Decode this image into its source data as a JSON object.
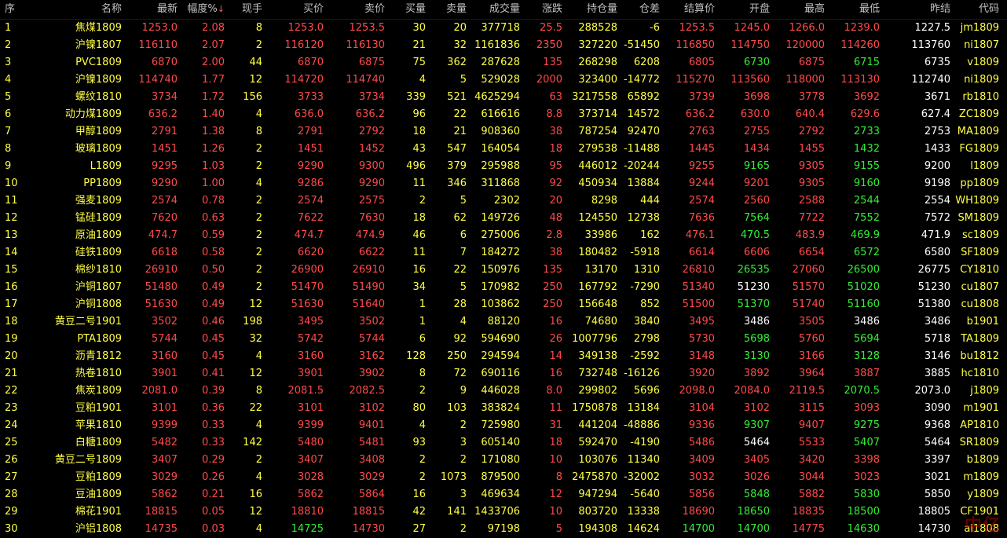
{
  "colors": {
    "up": "#ff4a4a",
    "down": "#33ee33",
    "neutral": "#ffffff",
    "text": "#ffff44",
    "header": "#c0c0c0",
    "bg": "#000000"
  },
  "headers": [
    "序",
    "名称",
    "最新",
    "幅度%",
    "现手",
    "买价",
    "卖价",
    "买量",
    "卖量",
    "成交量",
    "涨跌",
    "持仓量",
    "仓差",
    "结算价",
    "开盘",
    "最高",
    "最低",
    "昨结",
    "代码"
  ],
  "sort_indicator": "↓",
  "watermark": "中亿",
  "rows": [
    {
      "idx": "1",
      "name": "焦煤1809",
      "last": "1253.0",
      "pct": "2.08",
      "vol": "8",
      "bid": "1253.0",
      "ask": "1253.5",
      "bidv": "30",
      "askv": "20",
      "turnover": "377718",
      "chg": "25.5",
      "oi": "288528",
      "oid": "-6",
      "settle": "1253.5",
      "open": "1245.0",
      "high": "1266.0",
      "low": "1239.0",
      "prev": "1227.5",
      "code": "jm1809",
      "open_c": "up",
      "high_c": "up",
      "low_c": "up"
    },
    {
      "idx": "2",
      "name": "沪镍1807",
      "last": "116110",
      "pct": "2.07",
      "vol": "2",
      "bid": "116120",
      "ask": "116130",
      "bidv": "21",
      "askv": "32",
      "turnover": "1161836",
      "chg": "2350",
      "oi": "327220",
      "oid": "-51450",
      "settle": "116850",
      "open": "114750",
      "high": "120000",
      "low": "114260",
      "prev": "113760",
      "code": "ni1807",
      "open_c": "up",
      "high_c": "up",
      "low_c": "up"
    },
    {
      "idx": "3",
      "name": "PVC1809",
      "last": "6870",
      "pct": "2.00",
      "vol": "44",
      "bid": "6870",
      "ask": "6875",
      "bidv": "75",
      "askv": "362",
      "turnover": "287628",
      "chg": "135",
      "oi": "268298",
      "oid": "6208",
      "settle": "6805",
      "open": "6730",
      "high": "6875",
      "low": "6715",
      "prev": "6735",
      "code": "v1809",
      "open_c": "down",
      "high_c": "up",
      "low_c": "down"
    },
    {
      "idx": "4",
      "name": "沪镍1809",
      "last": "114740",
      "pct": "1.77",
      "vol": "12",
      "bid": "114720",
      "ask": "114740",
      "bidv": "4",
      "askv": "5",
      "turnover": "529028",
      "chg": "2000",
      "oi": "323400",
      "oid": "-14772",
      "settle": "115270",
      "open": "113560",
      "high": "118000",
      "low": "113130",
      "prev": "112740",
      "code": "ni1809",
      "open_c": "up",
      "high_c": "up",
      "low_c": "up"
    },
    {
      "idx": "5",
      "name": "螺纹1810",
      "last": "3734",
      "pct": "1.72",
      "vol": "156",
      "bid": "3733",
      "ask": "3734",
      "bidv": "339",
      "askv": "521",
      "turnover": "4625294",
      "chg": "63",
      "oi": "3217558",
      "oid": "65892",
      "settle": "3739",
      "open": "3698",
      "high": "3778",
      "low": "3692",
      "prev": "3671",
      "code": "rb1810",
      "open_c": "up",
      "high_c": "up",
      "low_c": "up"
    },
    {
      "idx": "6",
      "name": "动力煤1809",
      "last": "636.2",
      "pct": "1.40",
      "vol": "4",
      "bid": "636.0",
      "ask": "636.2",
      "bidv": "96",
      "askv": "22",
      "turnover": "616616",
      "chg": "8.8",
      "oi": "373714",
      "oid": "14572",
      "settle": "636.2",
      "open": "630.0",
      "high": "640.4",
      "low": "629.6",
      "prev": "627.4",
      "code": "ZC1809",
      "open_c": "up",
      "high_c": "up",
      "low_c": "up"
    },
    {
      "idx": "7",
      "name": "甲醇1809",
      "last": "2791",
      "pct": "1.38",
      "vol": "8",
      "bid": "2791",
      "ask": "2792",
      "bidv": "18",
      "askv": "21",
      "turnover": "908360",
      "chg": "38",
      "oi": "787254",
      "oid": "92470",
      "settle": "2763",
      "open": "2755",
      "high": "2792",
      "low": "2733",
      "prev": "2753",
      "code": "MA1809",
      "open_c": "up",
      "high_c": "up",
      "low_c": "down"
    },
    {
      "idx": "8",
      "name": "玻璃1809",
      "last": "1451",
      "pct": "1.26",
      "vol": "2",
      "bid": "1451",
      "ask": "1452",
      "bidv": "43",
      "askv": "547",
      "turnover": "164054",
      "chg": "18",
      "oi": "279538",
      "oid": "-11488",
      "settle": "1445",
      "open": "1434",
      "high": "1455",
      "low": "1432",
      "prev": "1433",
      "code": "FG1809",
      "open_c": "up",
      "high_c": "up",
      "low_c": "down"
    },
    {
      "idx": "9",
      "name": "L1809",
      "last": "9295",
      "pct": "1.03",
      "vol": "2",
      "bid": "9290",
      "ask": "9300",
      "bidv": "496",
      "askv": "379",
      "turnover": "295988",
      "chg": "95",
      "oi": "446012",
      "oid": "-20244",
      "settle": "9255",
      "open": "9165",
      "high": "9305",
      "low": "9155",
      "prev": "9200",
      "code": "l1809",
      "open_c": "down",
      "high_c": "up",
      "low_c": "down"
    },
    {
      "idx": "10",
      "name": "PP1809",
      "last": "9290",
      "pct": "1.00",
      "vol": "4",
      "bid": "9286",
      "ask": "9290",
      "bidv": "11",
      "askv": "346",
      "turnover": "311868",
      "chg": "92",
      "oi": "450934",
      "oid": "13884",
      "settle": "9244",
      "open": "9201",
      "high": "9305",
      "low": "9160",
      "prev": "9198",
      "code": "pp1809",
      "open_c": "up",
      "high_c": "up",
      "low_c": "down"
    },
    {
      "idx": "11",
      "name": "强麦1809",
      "last": "2574",
      "pct": "0.78",
      "vol": "2",
      "bid": "2574",
      "ask": "2575",
      "bidv": "2",
      "askv": "5",
      "turnover": "2302",
      "chg": "20",
      "oi": "8298",
      "oid": "444",
      "settle": "2574",
      "open": "2560",
      "high": "2588",
      "low": "2544",
      "prev": "2554",
      "code": "WH1809",
      "open_c": "up",
      "high_c": "up",
      "low_c": "down"
    },
    {
      "idx": "12",
      "name": "锰硅1809",
      "last": "7620",
      "pct": "0.63",
      "vol": "2",
      "bid": "7622",
      "ask": "7630",
      "bidv": "18",
      "askv": "62",
      "turnover": "149726",
      "chg": "48",
      "oi": "124550",
      "oid": "12738",
      "settle": "7636",
      "open": "7564",
      "high": "7722",
      "low": "7552",
      "prev": "7572",
      "code": "SM1809",
      "open_c": "down",
      "high_c": "up",
      "low_c": "down"
    },
    {
      "idx": "13",
      "name": "原油1809",
      "last": "474.7",
      "pct": "0.59",
      "vol": "2",
      "bid": "474.7",
      "ask": "474.9",
      "bidv": "46",
      "askv": "6",
      "turnover": "275006",
      "chg": "2.8",
      "oi": "33986",
      "oid": "162",
      "settle": "476.1",
      "open": "470.5",
      "high": "483.9",
      "low": "469.9",
      "prev": "471.9",
      "code": "sc1809",
      "open_c": "down",
      "high_c": "up",
      "low_c": "down"
    },
    {
      "idx": "14",
      "name": "硅铁1809",
      "last": "6618",
      "pct": "0.58",
      "vol": "2",
      "bid": "6620",
      "ask": "6622",
      "bidv": "11",
      "askv": "7",
      "turnover": "184272",
      "chg": "38",
      "oi": "180482",
      "oid": "-5918",
      "settle": "6614",
      "open": "6606",
      "high": "6654",
      "low": "6572",
      "prev": "6580",
      "code": "SF1809",
      "open_c": "up",
      "high_c": "up",
      "low_c": "down"
    },
    {
      "idx": "15",
      "name": "棉纱1810",
      "last": "26910",
      "pct": "0.50",
      "vol": "2",
      "bid": "26900",
      "ask": "26910",
      "bidv": "16",
      "askv": "22",
      "turnover": "150976",
      "chg": "135",
      "oi": "13170",
      "oid": "1310",
      "settle": "26810",
      "open": "26535",
      "high": "27060",
      "low": "26500",
      "prev": "26775",
      "code": "CY1810",
      "open_c": "down",
      "high_c": "up",
      "low_c": "down"
    },
    {
      "idx": "16",
      "name": "沪铜1807",
      "last": "51480",
      "pct": "0.49",
      "vol": "2",
      "bid": "51470",
      "ask": "51490",
      "bidv": "34",
      "askv": "5",
      "turnover": "170982",
      "chg": "250",
      "oi": "167792",
      "oid": "-7290",
      "settle": "51340",
      "open": "51230",
      "high": "51570",
      "low": "51020",
      "prev": "51230",
      "code": "cu1807",
      "open_c": "neutral",
      "high_c": "up",
      "low_c": "down"
    },
    {
      "idx": "17",
      "name": "沪铜1808",
      "last": "51630",
      "pct": "0.49",
      "vol": "12",
      "bid": "51630",
      "ask": "51640",
      "bidv": "1",
      "askv": "28",
      "turnover": "103862",
      "chg": "250",
      "oi": "156648",
      "oid": "852",
      "settle": "51500",
      "open": "51370",
      "high": "51740",
      "low": "51160",
      "prev": "51380",
      "code": "cu1808",
      "open_c": "down",
      "high_c": "up",
      "low_c": "down"
    },
    {
      "idx": "18",
      "name": "黄豆二号1901",
      "last": "3502",
      "pct": "0.46",
      "vol": "198",
      "bid": "3495",
      "ask": "3502",
      "bidv": "1",
      "askv": "4",
      "turnover": "88120",
      "chg": "16",
      "oi": "74680",
      "oid": "3840",
      "settle": "3495",
      "open": "3486",
      "high": "3505",
      "low": "3486",
      "prev": "3486",
      "code": "b1901",
      "open_c": "neutral",
      "high_c": "up",
      "low_c": "neutral"
    },
    {
      "idx": "19",
      "name": "PTA1809",
      "last": "5744",
      "pct": "0.45",
      "vol": "32",
      "bid": "5742",
      "ask": "5744",
      "bidv": "6",
      "askv": "92",
      "turnover": "594690",
      "chg": "26",
      "oi": "1007796",
      "oid": "2798",
      "settle": "5730",
      "open": "5698",
      "high": "5760",
      "low": "5694",
      "prev": "5718",
      "code": "TA1809",
      "open_c": "down",
      "high_c": "up",
      "low_c": "down"
    },
    {
      "idx": "20",
      "name": "沥青1812",
      "last": "3160",
      "pct": "0.45",
      "vol": "4",
      "bid": "3160",
      "ask": "3162",
      "bidv": "128",
      "askv": "250",
      "turnover": "294594",
      "chg": "14",
      "oi": "349138",
      "oid": "-2592",
      "settle": "3148",
      "open": "3130",
      "high": "3166",
      "low": "3128",
      "prev": "3146",
      "code": "bu1812",
      "open_c": "down",
      "high_c": "up",
      "low_c": "down"
    },
    {
      "idx": "21",
      "name": "热卷1810",
      "last": "3901",
      "pct": "0.41",
      "vol": "12",
      "bid": "3901",
      "ask": "3902",
      "bidv": "8",
      "askv": "72",
      "turnover": "690116",
      "chg": "16",
      "oi": "732748",
      "oid": "-16126",
      "settle": "3920",
      "open": "3892",
      "high": "3964",
      "low": "3887",
      "prev": "3885",
      "code": "hc1810",
      "open_c": "up",
      "high_c": "up",
      "low_c": "up"
    },
    {
      "idx": "22",
      "name": "焦炭1809",
      "last": "2081.0",
      "pct": "0.39",
      "vol": "8",
      "bid": "2081.5",
      "ask": "2082.5",
      "bidv": "2",
      "askv": "9",
      "turnover": "446028",
      "chg": "8.0",
      "oi": "299802",
      "oid": "5696",
      "settle": "2098.0",
      "open": "2084.0",
      "high": "2119.5",
      "low": "2070.5",
      "prev": "2073.0",
      "code": "j1809",
      "open_c": "up",
      "high_c": "up",
      "low_c": "down"
    },
    {
      "idx": "23",
      "name": "豆粕1901",
      "last": "3101",
      "pct": "0.36",
      "vol": "22",
      "bid": "3101",
      "ask": "3102",
      "bidv": "80",
      "askv": "103",
      "turnover": "383824",
      "chg": "11",
      "oi": "1750878",
      "oid": "13184",
      "settle": "3104",
      "open": "3102",
      "high": "3115",
      "low": "3093",
      "prev": "3090",
      "code": "m1901",
      "open_c": "up",
      "high_c": "up",
      "low_c": "up"
    },
    {
      "idx": "24",
      "name": "苹果1810",
      "last": "9399",
      "pct": "0.33",
      "vol": "4",
      "bid": "9399",
      "ask": "9401",
      "bidv": "4",
      "askv": "2",
      "turnover": "725980",
      "chg": "31",
      "oi": "441204",
      "oid": "-48886",
      "settle": "9336",
      "open": "9307",
      "high": "9407",
      "low": "9275",
      "prev": "9368",
      "code": "AP1810",
      "open_c": "down",
      "high_c": "up",
      "low_c": "down"
    },
    {
      "idx": "25",
      "name": "白糖1809",
      "last": "5482",
      "pct": "0.33",
      "vol": "142",
      "bid": "5480",
      "ask": "5481",
      "bidv": "93",
      "askv": "3",
      "turnover": "605140",
      "chg": "18",
      "oi": "592470",
      "oid": "-4190",
      "settle": "5486",
      "open": "5464",
      "high": "5533",
      "low": "5407",
      "prev": "5464",
      "code": "SR1809",
      "open_c": "neutral",
      "high_c": "up",
      "low_c": "down"
    },
    {
      "idx": "26",
      "name": "黄豆二号1809",
      "last": "3407",
      "pct": "0.29",
      "vol": "2",
      "bid": "3407",
      "ask": "3408",
      "bidv": "2",
      "askv": "2",
      "turnover": "171080",
      "chg": "10",
      "oi": "103076",
      "oid": "11340",
      "settle": "3409",
      "open": "3405",
      "high": "3420",
      "low": "3398",
      "prev": "3397",
      "code": "b1809",
      "open_c": "up",
      "high_c": "up",
      "low_c": "up"
    },
    {
      "idx": "27",
      "name": "豆粕1809",
      "last": "3029",
      "pct": "0.26",
      "vol": "4",
      "bid": "3028",
      "ask": "3029",
      "bidv": "2",
      "askv": "1073",
      "turnover": "879500",
      "chg": "8",
      "oi": "2475870",
      "oid": "-32002",
      "settle": "3032",
      "open": "3026",
      "high": "3044",
      "low": "3023",
      "prev": "3021",
      "code": "m1809",
      "open_c": "up",
      "high_c": "up",
      "low_c": "up"
    },
    {
      "idx": "28",
      "name": "豆油1809",
      "last": "5862",
      "pct": "0.21",
      "vol": "16",
      "bid": "5862",
      "ask": "5864",
      "bidv": "16",
      "askv": "3",
      "turnover": "469634",
      "chg": "12",
      "oi": "947294",
      "oid": "-5640",
      "settle": "5856",
      "open": "5848",
      "high": "5882",
      "low": "5830",
      "prev": "5850",
      "code": "y1809",
      "open_c": "down",
      "high_c": "up",
      "low_c": "down"
    },
    {
      "idx": "29",
      "name": "棉花1901",
      "last": "18815",
      "pct": "0.05",
      "vol": "12",
      "bid": "18810",
      "ask": "18815",
      "bidv": "42",
      "askv": "141",
      "turnover": "1433706",
      "chg": "10",
      "oi": "803720",
      "oid": "13338",
      "settle": "18690",
      "open": "18650",
      "high": "18835",
      "low": "18500",
      "prev": "18805",
      "code": "CF1901",
      "open_c": "down",
      "high_c": "up",
      "low_c": "down"
    },
    {
      "idx": "30",
      "name": "沪铝1808",
      "last": "14735",
      "pct": "0.03",
      "vol": "4",
      "bid": "14725",
      "ask": "14730",
      "bidv": "27",
      "askv": "2",
      "turnover": "97198",
      "chg": "5",
      "oi": "194308",
      "oid": "14624",
      "settle": "14700",
      "open": "14700",
      "high": "14775",
      "low": "14630",
      "prev": "14730",
      "code": "al1808",
      "open_c": "down",
      "high_c": "up",
      "low_c": "down",
      "bid_c": "down",
      "settle_c": "down"
    }
  ]
}
